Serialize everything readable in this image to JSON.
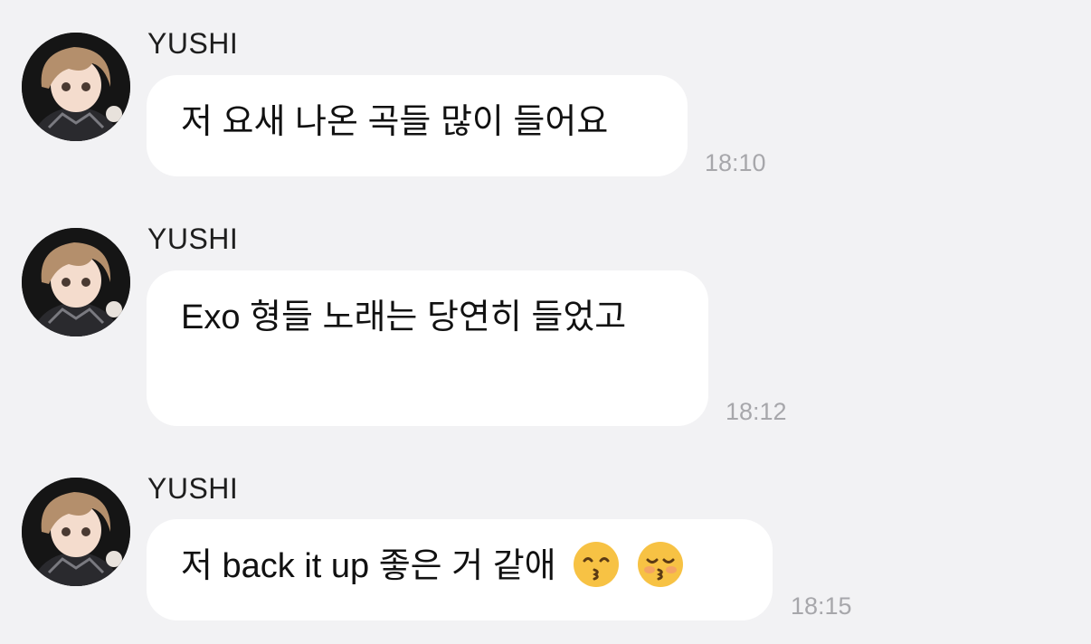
{
  "messages": [
    {
      "sender": "YUSHI",
      "text": "저 요새 나온 곡들 많이 들어요",
      "time": "18:10"
    },
    {
      "sender": "YUSHI",
      "text": "Exo 형들 노래는 당연히 들었고",
      "time": "18:12"
    },
    {
      "sender": "YUSHI",
      "text": "저 back it up 좋은 거 같애",
      "time": "18:15",
      "emojis": [
        "kissing-smiling-eyes-icon",
        "kissing-closed-eyes-icon"
      ]
    }
  ],
  "colors": {
    "background": "#f2f2f4",
    "bubble": "#ffffff",
    "timestamp": "#a7a7ab",
    "text": "#111111"
  }
}
